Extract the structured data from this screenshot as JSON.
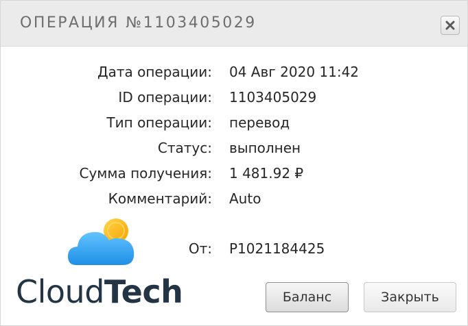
{
  "dialog": {
    "title": "ОПЕРАЦИЯ №1103405029",
    "close_icon": "close-icon"
  },
  "details": [
    {
      "label": "Дата операции:",
      "value": "04 Авг 2020 11:42"
    },
    {
      "label": "ID операции:",
      "value": "1103405029"
    },
    {
      "label": "Тип операции:",
      "value": "перевод"
    },
    {
      "label": "Статус:",
      "value": "выполнен"
    },
    {
      "label": "Сумма получения:",
      "value": "1 481.92 ₽"
    },
    {
      "label": "Комментарий:",
      "value": "Auto"
    },
    {
      "label": "От:",
      "value": "P1021184425"
    }
  ],
  "brand": {
    "part1": "Cloud",
    "part2": "Tech",
    "icon": "cloud-sun-logo-icon"
  },
  "buttons": {
    "balance_label": "Баланс",
    "close_label": "Закрыть"
  },
  "colors": {
    "titlebar_bg": "#ebebeb",
    "text": "#262626",
    "brand_dark": "#233545",
    "cloud_blue": "#2aa3f0",
    "sun_yellow": "#ffc107"
  }
}
